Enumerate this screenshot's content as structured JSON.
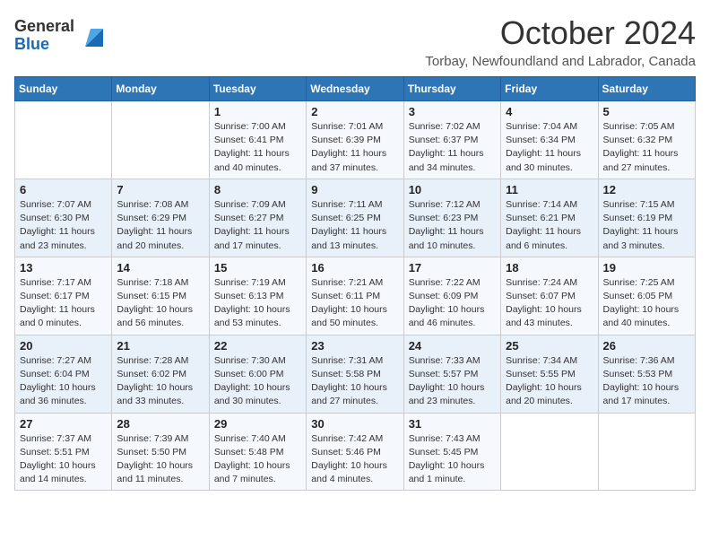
{
  "header": {
    "logo_general": "General",
    "logo_blue": "Blue",
    "month_title": "October 2024",
    "subtitle": "Torbay, Newfoundland and Labrador, Canada"
  },
  "days_of_week": [
    "Sunday",
    "Monday",
    "Tuesday",
    "Wednesday",
    "Thursday",
    "Friday",
    "Saturday"
  ],
  "weeks": [
    [
      {
        "day": "",
        "info": ""
      },
      {
        "day": "",
        "info": ""
      },
      {
        "day": "1",
        "info": "Sunrise: 7:00 AM\nSunset: 6:41 PM\nDaylight: 11 hours and 40 minutes."
      },
      {
        "day": "2",
        "info": "Sunrise: 7:01 AM\nSunset: 6:39 PM\nDaylight: 11 hours and 37 minutes."
      },
      {
        "day": "3",
        "info": "Sunrise: 7:02 AM\nSunset: 6:37 PM\nDaylight: 11 hours and 34 minutes."
      },
      {
        "day": "4",
        "info": "Sunrise: 7:04 AM\nSunset: 6:34 PM\nDaylight: 11 hours and 30 minutes."
      },
      {
        "day": "5",
        "info": "Sunrise: 7:05 AM\nSunset: 6:32 PM\nDaylight: 11 hours and 27 minutes."
      }
    ],
    [
      {
        "day": "6",
        "info": "Sunrise: 7:07 AM\nSunset: 6:30 PM\nDaylight: 11 hours and 23 minutes."
      },
      {
        "day": "7",
        "info": "Sunrise: 7:08 AM\nSunset: 6:29 PM\nDaylight: 11 hours and 20 minutes."
      },
      {
        "day": "8",
        "info": "Sunrise: 7:09 AM\nSunset: 6:27 PM\nDaylight: 11 hours and 17 minutes."
      },
      {
        "day": "9",
        "info": "Sunrise: 7:11 AM\nSunset: 6:25 PM\nDaylight: 11 hours and 13 minutes."
      },
      {
        "day": "10",
        "info": "Sunrise: 7:12 AM\nSunset: 6:23 PM\nDaylight: 11 hours and 10 minutes."
      },
      {
        "day": "11",
        "info": "Sunrise: 7:14 AM\nSunset: 6:21 PM\nDaylight: 11 hours and 6 minutes."
      },
      {
        "day": "12",
        "info": "Sunrise: 7:15 AM\nSunset: 6:19 PM\nDaylight: 11 hours and 3 minutes."
      }
    ],
    [
      {
        "day": "13",
        "info": "Sunrise: 7:17 AM\nSunset: 6:17 PM\nDaylight: 11 hours and 0 minutes."
      },
      {
        "day": "14",
        "info": "Sunrise: 7:18 AM\nSunset: 6:15 PM\nDaylight: 10 hours and 56 minutes."
      },
      {
        "day": "15",
        "info": "Sunrise: 7:19 AM\nSunset: 6:13 PM\nDaylight: 10 hours and 53 minutes."
      },
      {
        "day": "16",
        "info": "Sunrise: 7:21 AM\nSunset: 6:11 PM\nDaylight: 10 hours and 50 minutes."
      },
      {
        "day": "17",
        "info": "Sunrise: 7:22 AM\nSunset: 6:09 PM\nDaylight: 10 hours and 46 minutes."
      },
      {
        "day": "18",
        "info": "Sunrise: 7:24 AM\nSunset: 6:07 PM\nDaylight: 10 hours and 43 minutes."
      },
      {
        "day": "19",
        "info": "Sunrise: 7:25 AM\nSunset: 6:05 PM\nDaylight: 10 hours and 40 minutes."
      }
    ],
    [
      {
        "day": "20",
        "info": "Sunrise: 7:27 AM\nSunset: 6:04 PM\nDaylight: 10 hours and 36 minutes."
      },
      {
        "day": "21",
        "info": "Sunrise: 7:28 AM\nSunset: 6:02 PM\nDaylight: 10 hours and 33 minutes."
      },
      {
        "day": "22",
        "info": "Sunrise: 7:30 AM\nSunset: 6:00 PM\nDaylight: 10 hours and 30 minutes."
      },
      {
        "day": "23",
        "info": "Sunrise: 7:31 AM\nSunset: 5:58 PM\nDaylight: 10 hours and 27 minutes."
      },
      {
        "day": "24",
        "info": "Sunrise: 7:33 AM\nSunset: 5:57 PM\nDaylight: 10 hours and 23 minutes."
      },
      {
        "day": "25",
        "info": "Sunrise: 7:34 AM\nSunset: 5:55 PM\nDaylight: 10 hours and 20 minutes."
      },
      {
        "day": "26",
        "info": "Sunrise: 7:36 AM\nSunset: 5:53 PM\nDaylight: 10 hours and 17 minutes."
      }
    ],
    [
      {
        "day": "27",
        "info": "Sunrise: 7:37 AM\nSunset: 5:51 PM\nDaylight: 10 hours and 14 minutes."
      },
      {
        "day": "28",
        "info": "Sunrise: 7:39 AM\nSunset: 5:50 PM\nDaylight: 10 hours and 11 minutes."
      },
      {
        "day": "29",
        "info": "Sunrise: 7:40 AM\nSunset: 5:48 PM\nDaylight: 10 hours and 7 minutes."
      },
      {
        "day": "30",
        "info": "Sunrise: 7:42 AM\nSunset: 5:46 PM\nDaylight: 10 hours and 4 minutes."
      },
      {
        "day": "31",
        "info": "Sunrise: 7:43 AM\nSunset: 5:45 PM\nDaylight: 10 hours and 1 minute."
      },
      {
        "day": "",
        "info": ""
      },
      {
        "day": "",
        "info": ""
      }
    ]
  ]
}
